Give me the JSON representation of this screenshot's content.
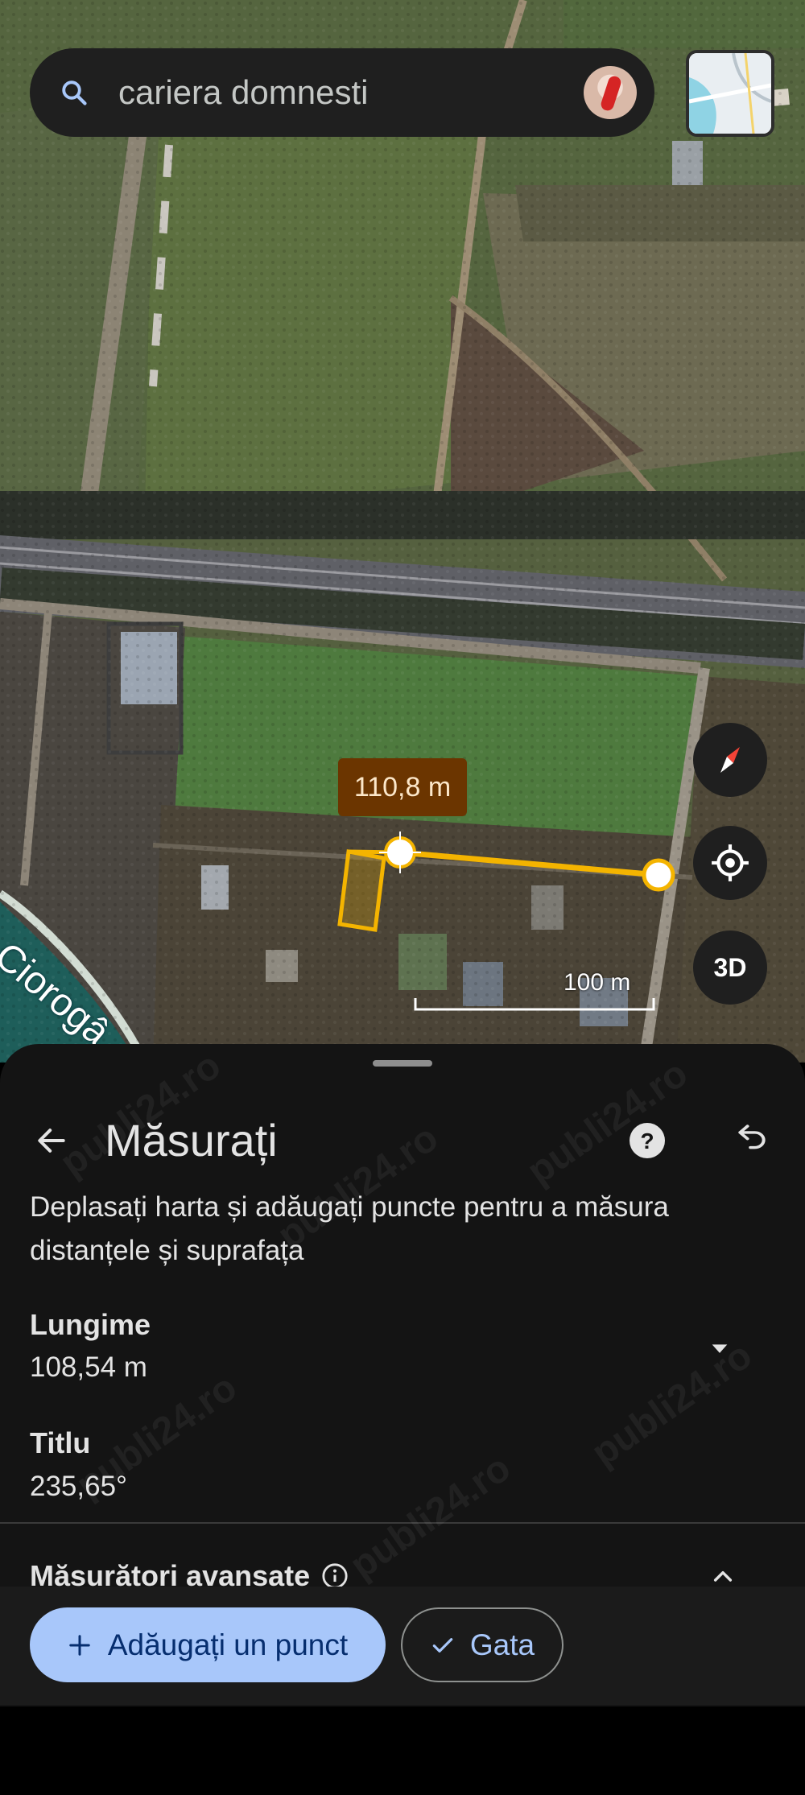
{
  "search": {
    "query": "cariera domnesti",
    "icon": "search-icon"
  },
  "map": {
    "distance_label": "110,8 m",
    "scale_label": "100 m",
    "place_label": "Ciorogâ",
    "buttons": {
      "three_d": "3D"
    }
  },
  "sheet": {
    "title": "Măsurați",
    "description": "Deplasați harta și adăugați puncte pentru a măsura distanțele și suprafața",
    "length": {
      "label": "Lungime",
      "value": "108,54 m"
    },
    "heading": {
      "label": "Titlu",
      "value": "235,65°"
    },
    "advanced": {
      "label": "Măsurători avansate"
    }
  },
  "actions": {
    "add_point": "Adăugați un punct",
    "done": "Gata"
  },
  "colors": {
    "measure_line": "#f4b400",
    "sheet_bg": "#141414",
    "primary_button": "#a8c7fa",
    "distance_label_bg": "#6b3500"
  },
  "watermark": "publi24.ro"
}
